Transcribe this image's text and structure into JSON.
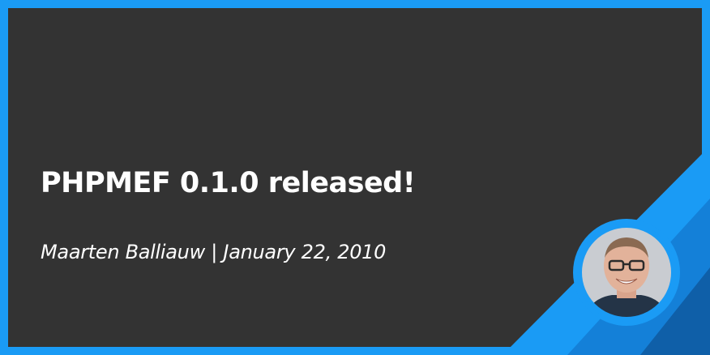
{
  "post": {
    "title": "PHPMEF 0.1.0 released!",
    "author": "Maarten Balliauw",
    "separator": "|",
    "date": "January 22, 2010"
  },
  "colors": {
    "frame": "#1a9bf5",
    "panel": "#333333",
    "accent_dark": "#1480d8",
    "accent_deep": "#0f5fa8",
    "text": "#ffffff"
  },
  "avatar": {
    "icon": "author-avatar"
  }
}
